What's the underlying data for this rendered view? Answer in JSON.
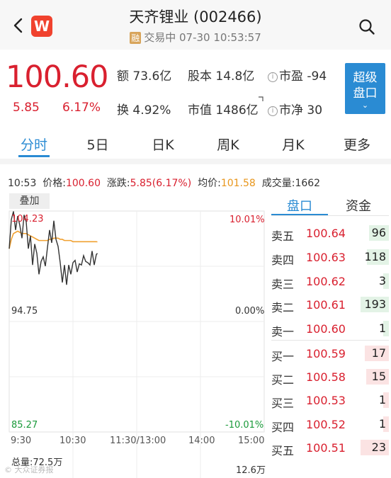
{
  "header": {
    "logo_text": "W",
    "title": "天齐锂业 (002466)",
    "badge": "融",
    "status": "交易中 07-30 10:53:57"
  },
  "quote": {
    "price": "100.60",
    "change": "5.85",
    "change_pct": "6.17%",
    "stats": [
      {
        "label": "额",
        "value": "73.6亿"
      },
      {
        "label": "股本",
        "value": "14.8亿"
      },
      {
        "label": "市盈",
        "value": "-94"
      },
      {
        "label": "换",
        "value": "4.92%"
      },
      {
        "label": "市值",
        "value": "1486亿"
      },
      {
        "label": "市净",
        "value": "30"
      }
    ],
    "super_button_line1": "超级",
    "super_button_line2": "盘口",
    "super_button_chevron": "⌄"
  },
  "tabs": [
    "分时",
    "5日",
    "日K",
    "周K",
    "月K",
    "更多"
  ],
  "active_tab": 0,
  "infoline": {
    "time": "10:53",
    "price_label": "价格:",
    "price": "100.60",
    "change_label": "涨跌:",
    "change": "5.85(6.17%)",
    "avg_label": "均价:",
    "avg": "101.58",
    "vol_label": "成交量:",
    "vol": "1662"
  },
  "chart": {
    "overlay_button": "叠加",
    "y_high": "104.23",
    "y_mid": "94.75",
    "y_low": "85.27",
    "pct_high": "10.01%",
    "pct_mid": "0.00%",
    "pct_low": "-10.01%",
    "x_ticks": [
      "9:30",
      "10:30",
      "11:30/13:00",
      "14:00",
      "15:00"
    ],
    "total_vol": "总量:72.5万",
    "max_vol": "12.6万",
    "watermark": "© 大众证券报",
    "colors": {
      "price_line": "#333333",
      "avg_line": "#f0a030",
      "up": "#d9202f",
      "down": "#1a9a3a"
    }
  },
  "chart_data": {
    "type": "line",
    "ylim": [
      85.27,
      104.23
    ],
    "x": [
      "9:30",
      "9:32",
      "9:34",
      "9:36",
      "9:38",
      "9:40",
      "9:42",
      "9:44",
      "9:46",
      "9:48",
      "9:50",
      "9:52",
      "9:54",
      "9:56",
      "9:58",
      "10:00",
      "10:02",
      "10:04",
      "10:06",
      "10:08",
      "10:10",
      "10:12",
      "10:14",
      "10:16",
      "10:18",
      "10:20",
      "10:22",
      "10:24",
      "10:26",
      "10:28",
      "10:30",
      "10:32",
      "10:34",
      "10:36",
      "10:38",
      "10:40",
      "10:42",
      "10:44",
      "10:46",
      "10:48",
      "10:50",
      "10:52",
      "10:53"
    ],
    "series": [
      {
        "values": [
          101.0,
          103.5,
          104.2,
          102.6,
          103.8,
          103.0,
          101.9,
          103.9,
          103.3,
          101.0,
          102.1,
          99.6,
          101.4,
          100.6,
          98.8,
          99.9,
          100.3,
          99.5,
          101.1,
          102.6,
          101.5,
          103.4,
          101.8,
          101.2,
          99.8,
          98.1,
          99.6,
          97.9,
          99.6,
          98.8,
          99.8,
          100.0,
          99.0,
          99.7,
          99.6,
          100.4,
          99.9,
          99.8,
          99.6,
          100.8,
          99.6,
          100.5,
          100.6
        ]
      },
      {
        "values": [
          101.0,
          101.8,
          102.3,
          102.4,
          102.5,
          102.4,
          102.3,
          102.3,
          102.3,
          102.2,
          102.1,
          102.0,
          101.9,
          101.8,
          101.7,
          101.7,
          101.7,
          101.7,
          101.7,
          101.8,
          101.8,
          101.9,
          101.9,
          101.9,
          101.8,
          101.8,
          101.7,
          101.7,
          101.7,
          101.7,
          101.6,
          101.6,
          101.6,
          101.6,
          101.6,
          101.6,
          101.6,
          101.6,
          101.6,
          101.6,
          101.6,
          101.6,
          101.58
        ]
      }
    ]
  },
  "order_book": {
    "tabs": [
      "盘口",
      "资金"
    ],
    "active": 0,
    "asks": [
      {
        "label": "卖五",
        "price": "100.64",
        "volume": "96",
        "vol_num": 96
      },
      {
        "label": "卖四",
        "price": "100.63",
        "volume": "118",
        "vol_num": 118
      },
      {
        "label": "卖三",
        "price": "100.62",
        "volume": "3",
        "vol_num": 3
      },
      {
        "label": "卖二",
        "price": "100.61",
        "volume": "193",
        "vol_num": 193
      },
      {
        "label": "卖一",
        "price": "100.60",
        "volume": "1",
        "vol_num": 1
      }
    ],
    "bids": [
      {
        "label": "买一",
        "price": "100.59",
        "volume": "17",
        "vol_num": 17
      },
      {
        "label": "买二",
        "price": "100.58",
        "volume": "15",
        "vol_num": 15
      },
      {
        "label": "买三",
        "price": "100.53",
        "volume": "1",
        "vol_num": 1
      },
      {
        "label": "买四",
        "price": "100.52",
        "volume": "1",
        "vol_num": 1
      },
      {
        "label": "买五",
        "price": "100.51",
        "volume": "23",
        "vol_num": 23
      }
    ],
    "colors": {
      "ask_bar": "#e3f3e6",
      "bid_bar": "#fbe3e3"
    }
  }
}
